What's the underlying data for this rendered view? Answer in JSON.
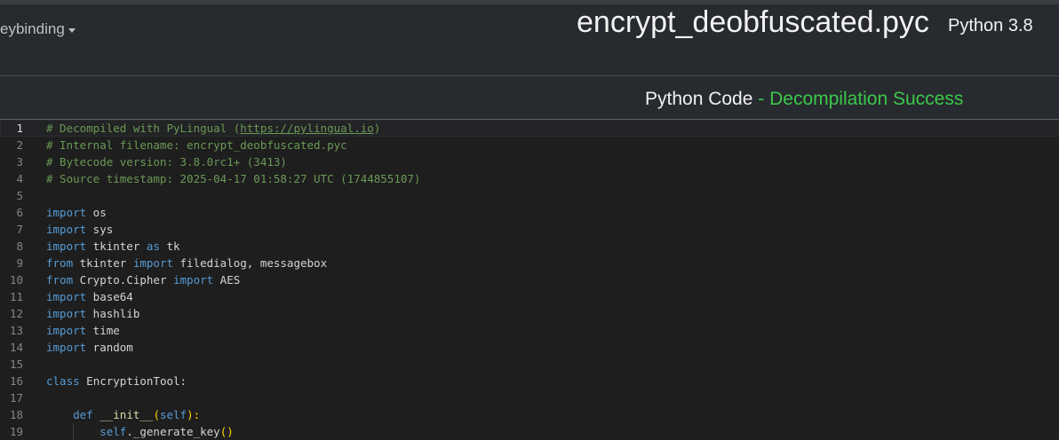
{
  "header": {
    "keybinding_label": "eybinding",
    "filename": "encrypt_deobfuscated.pyc",
    "python_version": "Python 3.8"
  },
  "subheader": {
    "title": "Python Code",
    "separator": " - ",
    "status": "Decompilation Success"
  },
  "editor": {
    "line_numbers": [
      "1",
      "2",
      "3",
      "4",
      "5",
      "6",
      "7",
      "8",
      "9",
      "10",
      "11",
      "12",
      "13",
      "14",
      "15",
      "16",
      "17",
      "18",
      "19"
    ],
    "lines": {
      "l1_pre": "# Decompiled with PyLingual (",
      "l1_url": "https://pylingual.io",
      "l1_post": ")",
      "l2": "# Internal filename: encrypt_deobfuscated.pyc",
      "l3": "# Bytecode version: 3.8.0rc1+ (3413)",
      "l4": "# Source timestamp: 2025-04-17 01:58:27 UTC (1744855107)",
      "import": "import",
      "from": "from",
      "as": "as",
      "class": "class",
      "def": "def",
      "l6": " os",
      "l7": " sys",
      "l8_a": " tkinter ",
      "l8_b": " tk",
      "l9_a": " tkinter ",
      "l9_b": " filedialog, messagebox",
      "l10_a": " Crypto.Cipher ",
      "l10_b": " AES",
      "l11": " base64",
      "l12": " hashlib",
      "l13": " time",
      "l14": " random",
      "l16": " EncryptionTool:",
      "l18_fn": "__init__",
      "l18_open": "(",
      "l18_self": "self",
      "l18_close": "):",
      "l19_self": "self",
      "l19_rest": "._generate_key",
      "l19_paren": "()"
    }
  }
}
